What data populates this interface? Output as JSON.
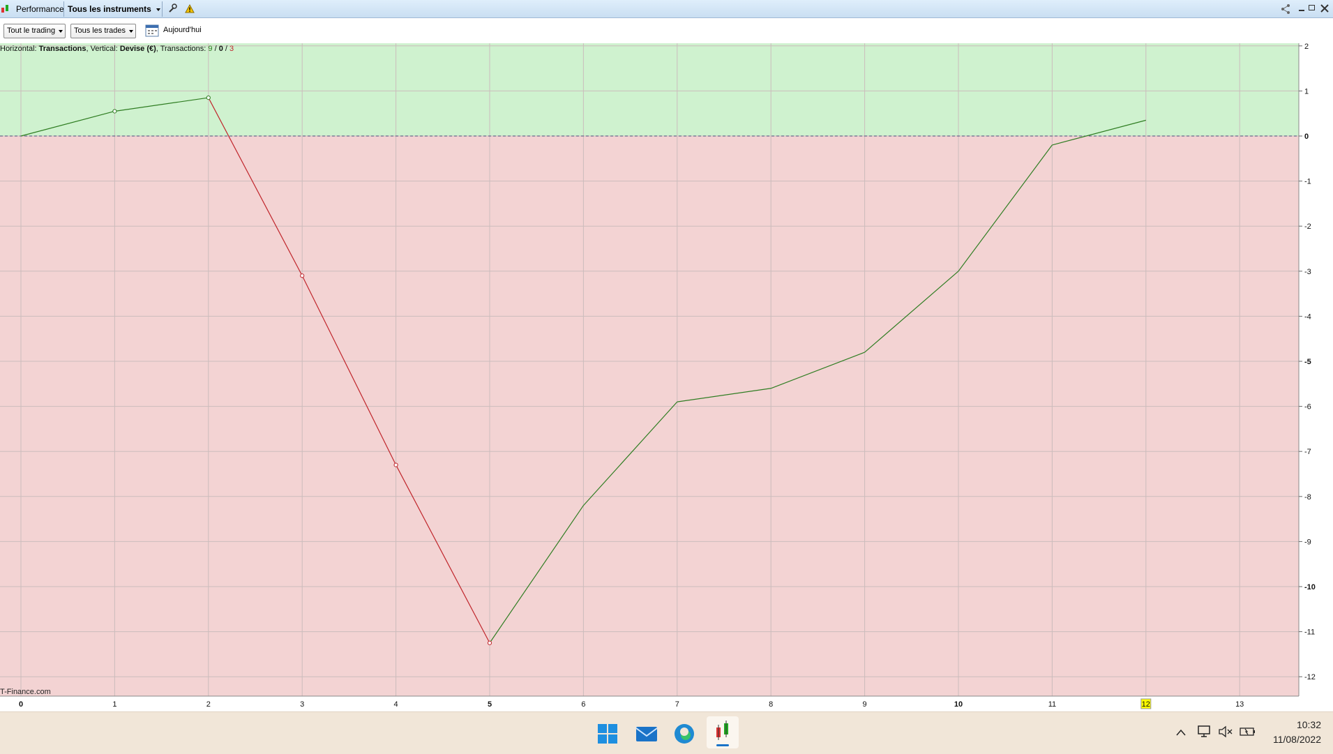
{
  "window": {
    "app_label": "Performance",
    "instrument_label": "Tous les instruments"
  },
  "toolbar": {
    "filter_trading": "Tout le trading",
    "filter_trades": "Tous les trades",
    "date_label": "Aujourd'hui"
  },
  "caption": {
    "h_label": "Horizontal:",
    "h_value": "Transactions",
    "v_label": ", Vertical:",
    "v_value": "Devise (€)",
    "t_label": ", Transactions:",
    "t_win": "9",
    "t_sep1": " / ",
    "t_flat": "0",
    "t_sep2": " / ",
    "t_loss": "3"
  },
  "brand": "T-Finance.com",
  "colors": {
    "profit_zone": "#cff2cf",
    "loss_zone": "#f3d3d3",
    "up_line": "#2f7d22",
    "down_line": "#c0262c",
    "highlight": "#ffff00"
  },
  "chart_data": {
    "type": "line",
    "x": [
      0,
      1,
      2,
      3,
      4,
      5,
      6,
      7,
      8,
      9,
      10,
      11,
      12
    ],
    "values": [
      0,
      0.55,
      0.85,
      -3.1,
      -7.3,
      -11.25,
      -8.2,
      -5.9,
      -5.6,
      -4.8,
      -3.0,
      -0.2,
      0.35
    ],
    "xlim": [
      0,
      13
    ],
    "ylim": [
      -12,
      2
    ],
    "x_ticks": [
      "0",
      "1",
      "2",
      "3",
      "4",
      "5",
      "6",
      "7",
      "8",
      "9",
      "10",
      "11",
      "12",
      "13"
    ],
    "x_bold_ticks": [
      "0",
      "5",
      "10"
    ],
    "x_highlight_tick": "12",
    "y_ticks": [
      "2",
      "1",
      "0",
      "-1",
      "-2",
      "-3",
      "-4",
      "-5",
      "-6",
      "-7",
      "-8",
      "-9",
      "-10",
      "-11",
      "-12"
    ],
    "y_bold_ticks": [
      "0",
      "-5",
      "-10"
    ],
    "grid": true,
    "zero_line": "dashed"
  },
  "taskbar": {
    "time": "10:32",
    "date": "11/08/2022",
    "icons": [
      "windows-start-icon",
      "mail-icon",
      "edge-browser-icon",
      "trading-app-icon"
    ]
  }
}
